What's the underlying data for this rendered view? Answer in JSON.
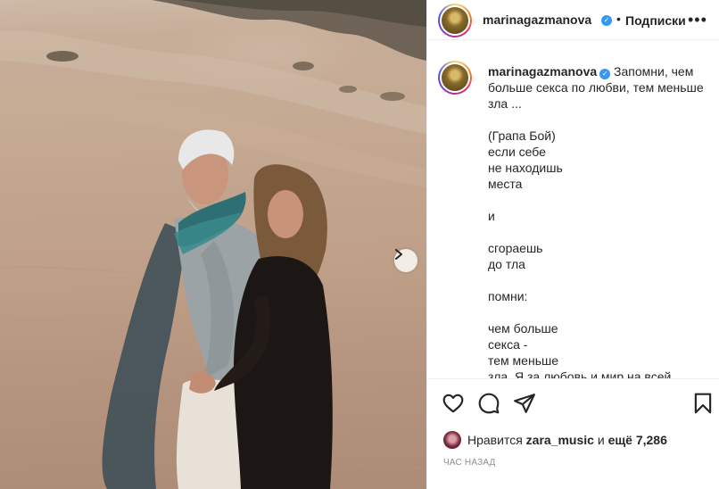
{
  "post": {
    "username": "marinagazmanova",
    "verified_mark": "✓",
    "dot": "•",
    "follow_label": "Подписки",
    "more_label": "•••",
    "caption_text": " Запомни, чем больше секса по любви, тем меньше зла ...\n\n(Грапа Бой)\nесли себе\nне находишь\nместа\n\nи\n\nсгораешь\nдо тла\n\nпомни:\n\nчем больше\nсекса -\nтем меньше\nзла. Я за любовь и мир на всей",
    "likes_prefix": "Нравится",
    "liker": "zara_music",
    "likes_middle": "и",
    "likes_count": "ещё 7,286",
    "time_label": "ЧАС НАЗАД"
  },
  "icons": {
    "like": "heart-icon",
    "comment": "comment-icon",
    "share": "share-icon",
    "save": "bookmark-icon",
    "next": "chevron-right-icon",
    "more": "more-icon"
  },
  "colors": {
    "verified": "#3897f0",
    "text": "#262626",
    "muted": "#8e8e8e",
    "border": "#efefef"
  }
}
